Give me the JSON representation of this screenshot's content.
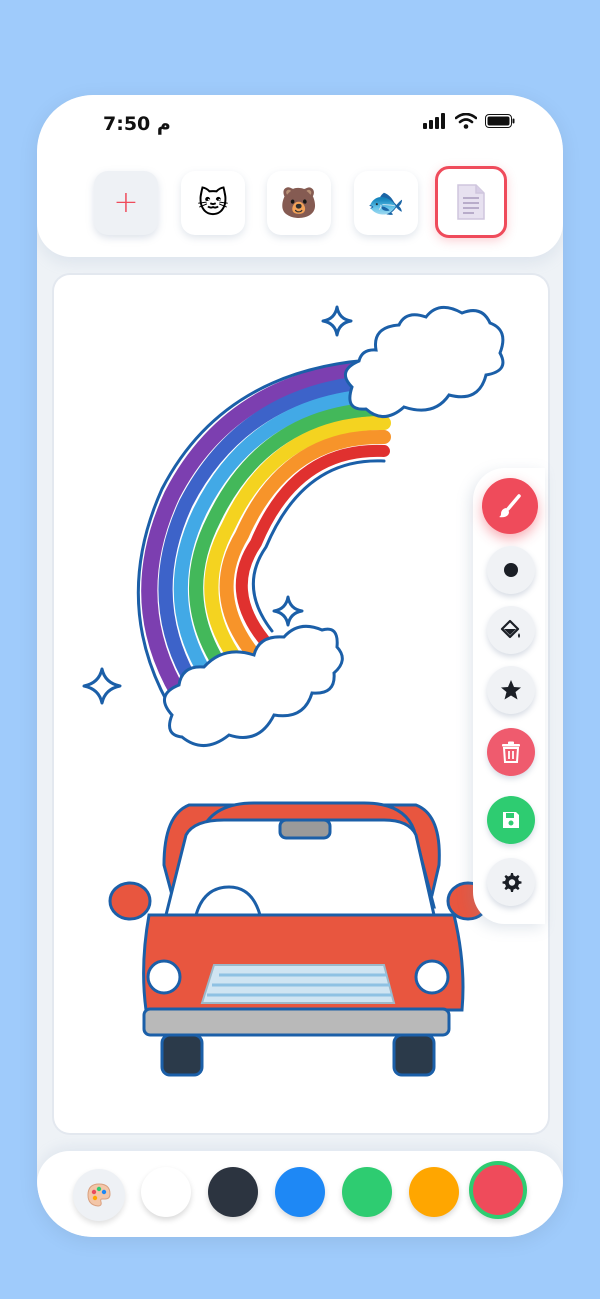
{
  "status_bar": {
    "time": "7:50 م"
  },
  "templates": [
    {
      "label": "+",
      "name": "add"
    },
    {
      "label": "🐱",
      "name": "cat"
    },
    {
      "label": "🐻",
      "name": "bear"
    },
    {
      "label": "🐟",
      "name": "fish"
    },
    {
      "label": "📄",
      "name": "page",
      "selected": true
    }
  ],
  "tools": [
    "brush-icon",
    "dot-icon",
    "paint-bucket-icon",
    "star-icon",
    "trash-icon",
    "save-icon",
    "gear-icon"
  ],
  "colors": {
    "accent_red": "#ef4b5b",
    "save_green": "#2ecc71",
    "background": "#9fcbfb"
  },
  "palette": {
    "swatches": [
      "#ffffff",
      "#2c3440",
      "#1e88f5",
      "#2ecc71",
      "#ffa600",
      "#ef4b5b"
    ],
    "selected": "#ef4b5b"
  }
}
